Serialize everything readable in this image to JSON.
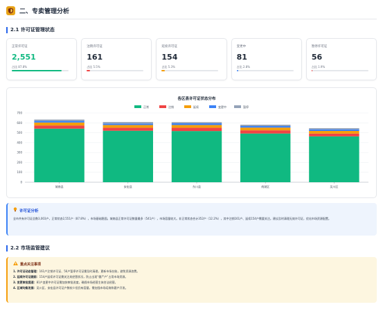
{
  "header": {
    "title": "二、专卖管理分析"
  },
  "sections": {
    "license": "2.1 许可证管理状态",
    "supervision": "2.2 市场监管建议"
  },
  "cards": [
    {
      "label": "正常许可证",
      "value": "2,551",
      "pct": "占比 87.8%",
      "ratio": 0.878,
      "color": "#10b981",
      "highlight": true
    },
    {
      "label": "注销许可证",
      "value": "161",
      "pct": "占比 5.5%",
      "ratio": 0.055,
      "color": "#ef4444",
      "highlight": false
    },
    {
      "label": "延续许可证",
      "value": "154",
      "pct": "占比 5.3%",
      "ratio": 0.053,
      "color": "#f59e0b",
      "highlight": false
    },
    {
      "label": "变更中",
      "value": "81",
      "pct": "占比 2.8%",
      "ratio": 0.028,
      "color": "#3b82f6",
      "highlight": false
    },
    {
      "label": "暂停许可证",
      "value": "56",
      "pct": "占比 1.9%",
      "ratio": 0.019,
      "color": "#ef4444",
      "highlight": false
    }
  ],
  "chart_data": {
    "type": "bar",
    "stacked": true,
    "title": "各区县许可证状态分布",
    "categories": [
      "城南县",
      "安宏县",
      "东川县",
      "南湖区",
      "吴川区"
    ],
    "series": [
      {
        "name": "正常",
        "color": "#10b981",
        "values": [
          541,
          520,
          517,
          492,
          463
        ]
      },
      {
        "name": "注销",
        "color": "#ef4444",
        "values": [
          32,
          30,
          33,
          32,
          28
        ]
      },
      {
        "name": "延续",
        "color": "#f59e0b",
        "values": [
          30,
          28,
          28,
          28,
          27
        ]
      },
      {
        "name": "变更中",
        "color": "#3b82f6",
        "values": [
          16,
          15,
          17,
          15,
          16
        ]
      },
      {
        "name": "暂停",
        "color": "#94a3b8",
        "values": [
          14,
          15,
          12,
          14,
          12
        ]
      }
    ],
    "ylim": [
      0,
      700
    ],
    "yticks": [
      0,
      100,
      200,
      300,
      400,
      500,
      600,
      700
    ],
    "legend": "top-center",
    "grid": true
  },
  "analysis": {
    "title": "许可证分析",
    "text": "全市共有许可证总数3,003户，正常状态2,551户（87.8%），市场基础稳固。城南县正常许可证数量最多（541户），市场容量较大。非正常状态合计352户（12.2%），其中注销161户、延续154户需要关注。建议及时清理无效许可证，优化市场资源配置。"
  },
  "warning": {
    "title": "重点关注事项",
    "items": [
      {
        "num": "1.",
        "label": "许可证动态管理：",
        "text": "161户注销许可证、56户暂停许可证需及时清理，更新市场台账，避免资源浪费。"
      },
      {
        "num": "2.",
        "label": "延续许可证跟踪：",
        "text": "154户延续许可证需关注其经营状况，防止出现“僵尸户”占用市场资源。"
      },
      {
        "num": "3.",
        "label": "变更审批提速：",
        "text": "81户变更中许可证需加快审批进度，确保市场经营主体合法经营。"
      },
      {
        "num": "4.",
        "label": "区域均衡发展：",
        "text": "吴川区、安宏县许可证户数较少但仍有容量，需加强市场培育和客户开发。"
      }
    ]
  }
}
